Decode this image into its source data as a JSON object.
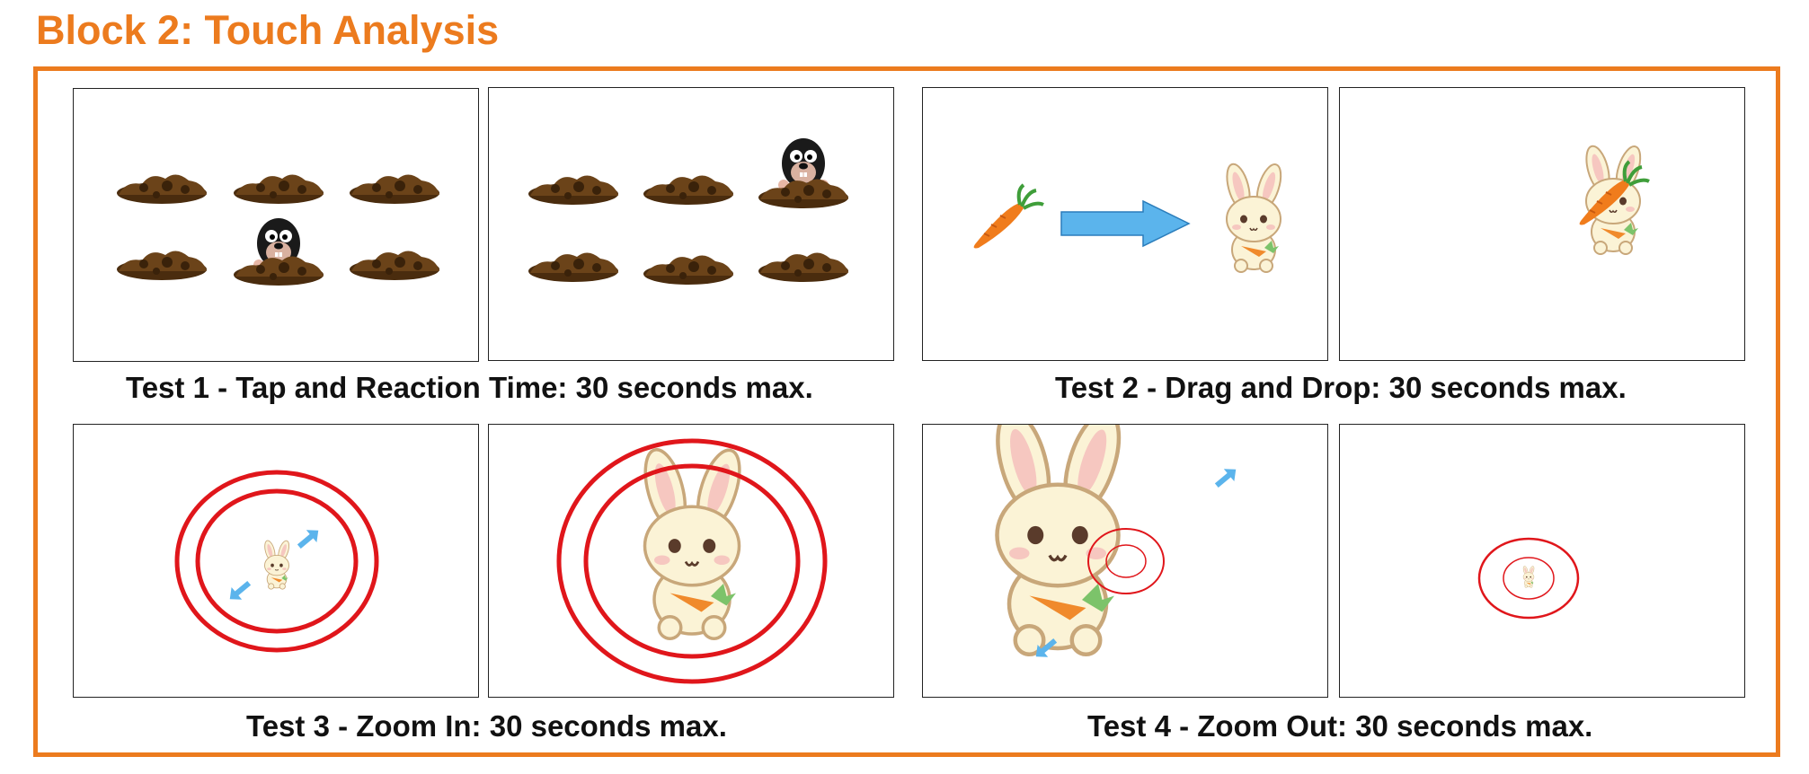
{
  "header": {
    "title": "Block 2: Touch Analysis"
  },
  "colors": {
    "accent": "#ec7b1e",
    "ring": "#e0161b",
    "arrow": "#5bb4ec"
  },
  "tests": [
    {
      "caption": "Test 1 - Tap and Reaction Time: 30 seconds max.",
      "panels": [
        "mole-in-lower-middle-hole",
        "mole-in-upper-right-hole"
      ]
    },
    {
      "caption": "Test 2 - Drag and Drop: 30 seconds max.",
      "panels": [
        "carrot-arrow-to-bunny",
        "carrot-dropped-on-bunny"
      ]
    },
    {
      "caption": "Test 3 - Zoom In: 30 seconds max.",
      "panels": [
        "small-bunny-with-pinch-arrows",
        "zoomed-in-bunny"
      ]
    },
    {
      "caption": "Test 4 - Zoom Out: 30 seconds max.",
      "panels": [
        "large-bunny-with-pinch-arrows",
        "zoomed-out-bunny"
      ]
    }
  ]
}
